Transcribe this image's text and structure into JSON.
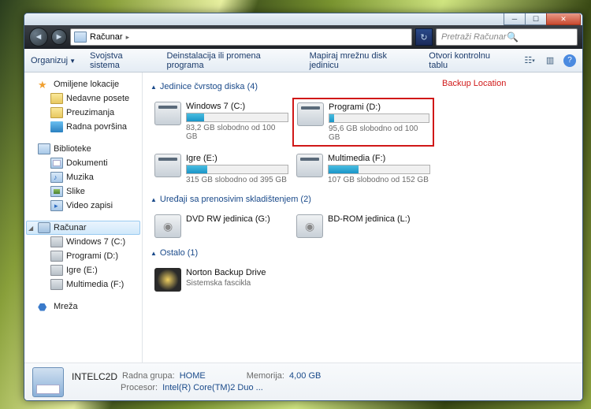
{
  "titlebar": {
    "min": "─",
    "max": "☐",
    "close": "✕"
  },
  "address": {
    "location": "Računar",
    "sep": "▸"
  },
  "search": {
    "placeholder": "Pretraži Računar"
  },
  "toolbar": {
    "organize": "Organizuj",
    "props": "Svojstva sistema",
    "uninstall": "Deinstalacija ili promena programa",
    "mapnet": "Mapiraj mrežnu disk jedinicu",
    "ctrlpanel": "Otvori kontrolnu tablu"
  },
  "nav": {
    "favorites": "Omiljene lokacije",
    "recent": "Nedavne posete",
    "downloads": "Preuzimanja",
    "desktop": "Radna površina",
    "libraries": "Biblioteke",
    "documents": "Dokumenti",
    "music": "Muzika",
    "pictures": "Slike",
    "videos": "Video zapisi",
    "computer": "Računar",
    "drive_c": "Windows 7 (C:)",
    "drive_d": "Programi (D:)",
    "drive_e": "Igre (E:)",
    "drive_f": "Multimedia (F:)",
    "network": "Mreža"
  },
  "sections": {
    "hdd": "Jedinice čvrstog diska (4)",
    "removable": "Uređaji sa prenosivim skladištenjem (2)",
    "other": "Ostalo (1)"
  },
  "drives": {
    "c": {
      "name": "Windows 7 (C:)",
      "free": "83,2 GB slobodno od 100 GB",
      "pct": 17
    },
    "d": {
      "name": "Programi (D:)",
      "free": "95,6 GB slobodno od 100 GB",
      "pct": 5
    },
    "e": {
      "name": "Igre (E:)",
      "free": "315 GB slobodno od 395 GB",
      "pct": 20
    },
    "f": {
      "name": "Multimedia (F:)",
      "free": "107 GB slobodno od 152 GB",
      "pct": 30
    },
    "g": {
      "name": "DVD RW jedinica (G:)"
    },
    "l": {
      "name": "BD-ROM jedinica (L:)"
    },
    "norton": {
      "name": "Norton Backup Drive",
      "sub": "Sistemska fascikla"
    }
  },
  "annotation": "Backup Location",
  "details": {
    "name": "INTELC2D",
    "group_label": "Radna grupa:",
    "group": "HOME",
    "cpu_label": "Procesor:",
    "cpu": "Intel(R) Core(TM)2 Duo ...",
    "mem_label": "Memorija:",
    "mem": "4,00 GB"
  }
}
